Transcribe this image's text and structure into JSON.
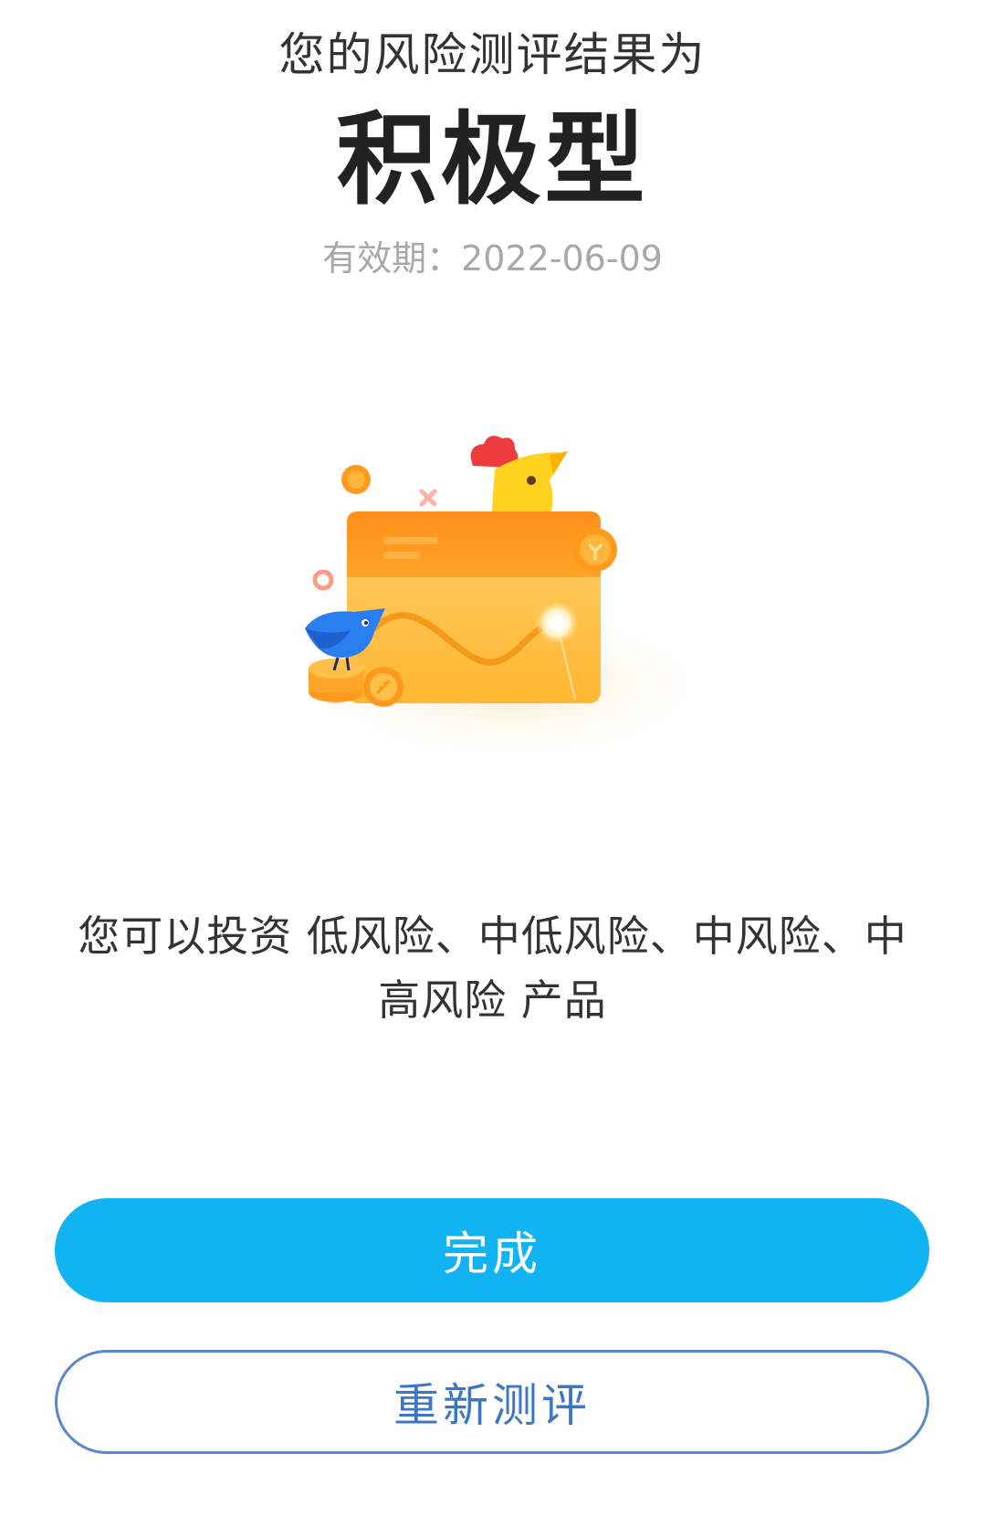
{
  "result": {
    "heading": "您的风险测评结果为",
    "type": "积极型",
    "validity": "有效期：2022-06-09"
  },
  "illustration": {
    "icon": "wallet-chicken-bird-illustration"
  },
  "investable": {
    "text": "您可以投资 低风险、中低风险、中风险、中高风险 产品"
  },
  "buttons": {
    "done_label": "完成",
    "retest_label": "重新测评"
  },
  "colors": {
    "primary": "#12b3f2",
    "outline": "#5a88c8",
    "text_dark": "#222222",
    "text_muted": "#a8a8a8",
    "wallet_top": "#ff9a1f",
    "wallet_body": "#ffc14a"
  }
}
